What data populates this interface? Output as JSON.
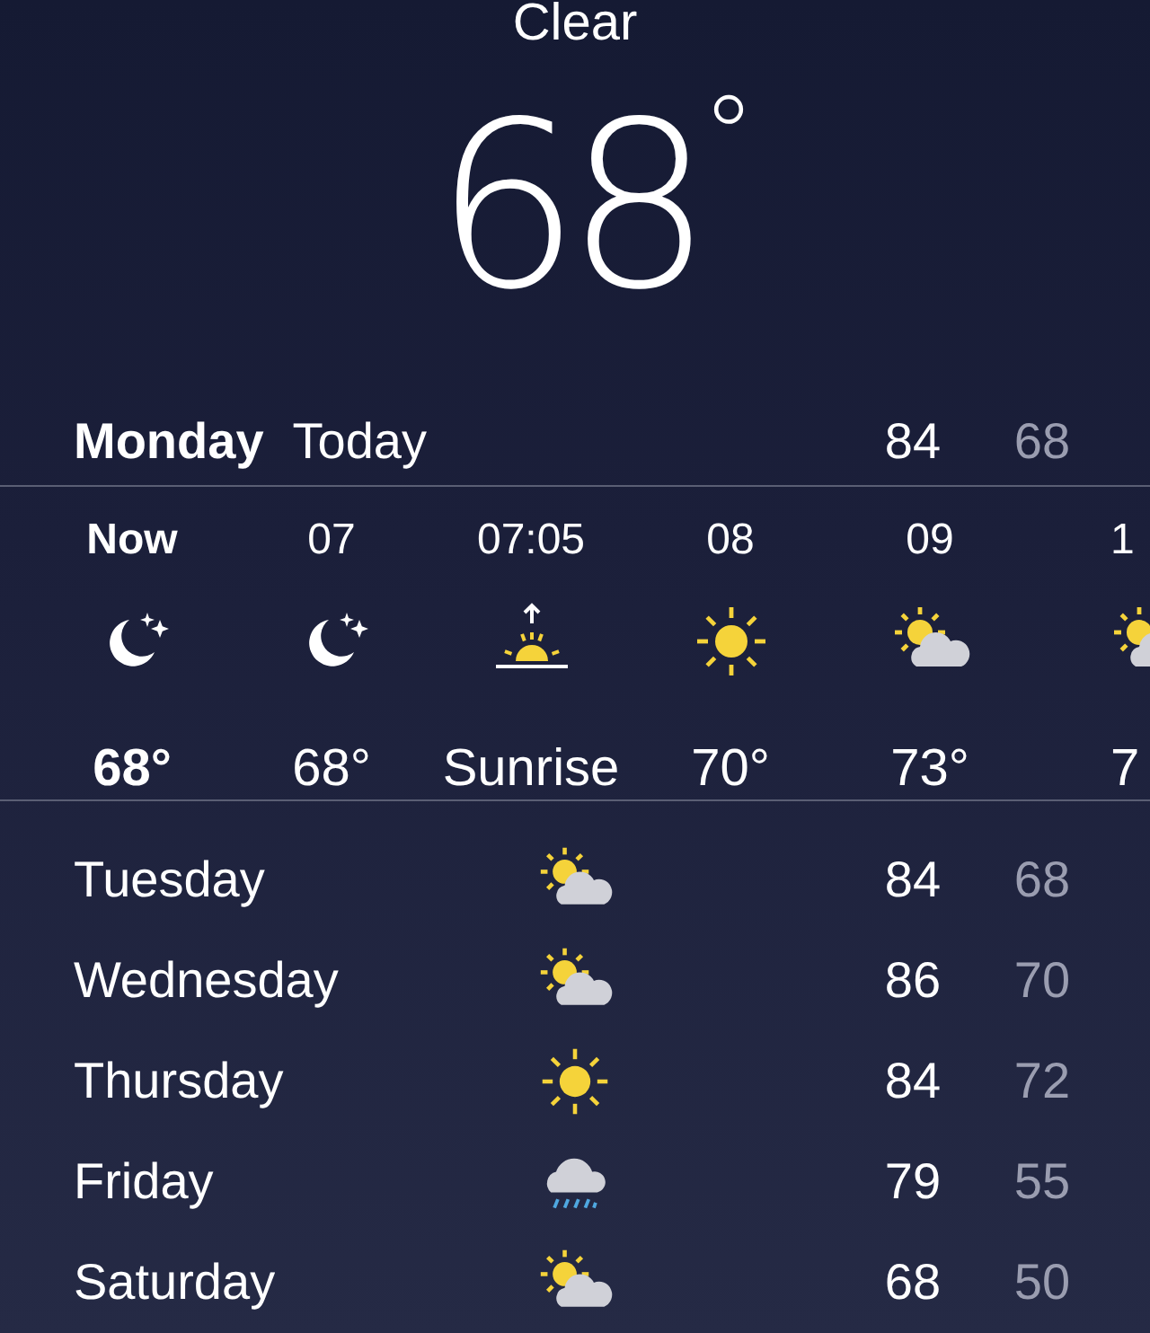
{
  "current": {
    "condition": "Clear",
    "temperature": "68",
    "degree_sign": "°"
  },
  "today": {
    "day": "Monday",
    "label": "Today",
    "high": "84",
    "low": "68"
  },
  "hourly": [
    {
      "time": "Now",
      "kind": "moon",
      "temp": "68°",
      "now": true
    },
    {
      "time": "07",
      "kind": "moon",
      "temp": "68°",
      "now": false
    },
    {
      "time": "07:05",
      "kind": "sunrise",
      "temp": "Sunrise",
      "now": false
    },
    {
      "time": "08",
      "kind": "sun",
      "temp": "70°",
      "now": false
    },
    {
      "time": "09",
      "kind": "cloudy",
      "temp": "73°",
      "now": false
    },
    {
      "time": "1",
      "kind": "cloudy",
      "temp": "7",
      "now": false
    }
  ],
  "daily": [
    {
      "day": "Tuesday",
      "kind": "cloudy",
      "high": "84",
      "low": "68"
    },
    {
      "day": "Wednesday",
      "kind": "cloudy",
      "high": "86",
      "low": "70"
    },
    {
      "day": "Thursday",
      "kind": "sun",
      "high": "84",
      "low": "72"
    },
    {
      "day": "Friday",
      "kind": "rain",
      "high": "79",
      "low": "55"
    },
    {
      "day": "Saturday",
      "kind": "cloudy",
      "high": "68",
      "low": "50"
    }
  ]
}
